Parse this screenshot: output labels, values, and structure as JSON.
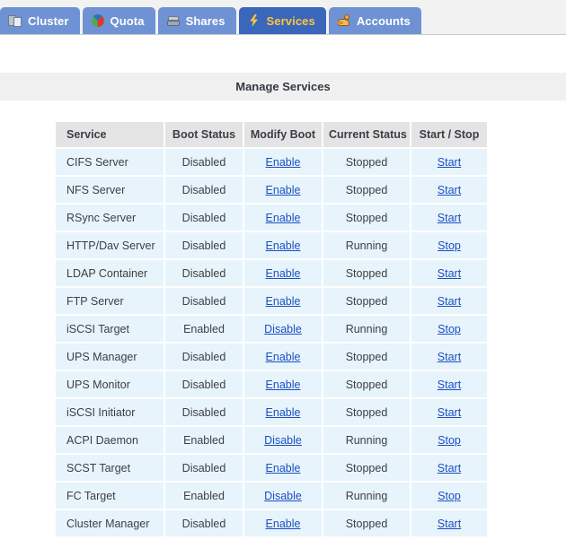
{
  "nav": {
    "tabs": [
      {
        "label": "Cluster",
        "icon": "cluster-icon",
        "active": false
      },
      {
        "label": "Quota",
        "icon": "quota-icon",
        "active": false
      },
      {
        "label": "Shares",
        "icon": "shares-icon",
        "active": false
      },
      {
        "label": "Services",
        "icon": "services-bolt-icon",
        "active": true
      },
      {
        "label": "Accounts",
        "icon": "accounts-icon",
        "active": false
      }
    ],
    "active_tab": "Services",
    "active_tab_text_color": "#ffc63c",
    "active_tab_bg_color": "#3a66bc",
    "tab_bg_color": "#6f92d4"
  },
  "banner": {
    "title": "Manage Services"
  },
  "colors": {
    "disabled_stopped": "#fcc853",
    "enabled_running": "#d9efb4",
    "row_bg": "#e8f4fb",
    "header_bg": "#e4e4e4",
    "link": "#1a4fc4"
  },
  "table": {
    "headers": {
      "service": "Service",
      "boot_status": "Boot Status",
      "modify_boot": "Modify Boot",
      "current_status": "Current Status",
      "start_stop": "Start / Stop"
    },
    "rows": [
      {
        "service": "CIFS Server",
        "boot_status": "Disabled",
        "boot_state": "off",
        "modify_boot": "Enable",
        "current_status": "Stopped",
        "run_state": "off",
        "start_stop": "Start"
      },
      {
        "service": "NFS Server",
        "boot_status": "Disabled",
        "boot_state": "off",
        "modify_boot": "Enable",
        "current_status": "Stopped",
        "run_state": "off",
        "start_stop": "Start"
      },
      {
        "service": "RSync Server",
        "boot_status": "Disabled",
        "boot_state": "off",
        "modify_boot": "Enable",
        "current_status": "Stopped",
        "run_state": "off",
        "start_stop": "Start"
      },
      {
        "service": "HTTP/Dav Server",
        "boot_status": "Disabled",
        "boot_state": "off",
        "modify_boot": "Enable",
        "current_status": "Running",
        "run_state": "on",
        "start_stop": "Stop"
      },
      {
        "service": "LDAP Container",
        "boot_status": "Disabled",
        "boot_state": "off",
        "modify_boot": "Enable",
        "current_status": "Stopped",
        "run_state": "off",
        "start_stop": "Start"
      },
      {
        "service": "FTP Server",
        "boot_status": "Disabled",
        "boot_state": "off",
        "modify_boot": "Enable",
        "current_status": "Stopped",
        "run_state": "off",
        "start_stop": "Start"
      },
      {
        "service": "iSCSI Target",
        "boot_status": "Enabled",
        "boot_state": "on",
        "modify_boot": "Disable",
        "current_status": "Running",
        "run_state": "on",
        "start_stop": "Stop"
      },
      {
        "service": "UPS Manager",
        "boot_status": "Disabled",
        "boot_state": "off",
        "modify_boot": "Enable",
        "current_status": "Stopped",
        "run_state": "off",
        "start_stop": "Start"
      },
      {
        "service": "UPS Monitor",
        "boot_status": "Disabled",
        "boot_state": "off",
        "modify_boot": "Enable",
        "current_status": "Stopped",
        "run_state": "off",
        "start_stop": "Start"
      },
      {
        "service": "iSCSI Initiator",
        "boot_status": "Disabled",
        "boot_state": "off",
        "modify_boot": "Enable",
        "current_status": "Stopped",
        "run_state": "off",
        "start_stop": "Start"
      },
      {
        "service": "ACPI Daemon",
        "boot_status": "Enabled",
        "boot_state": "on",
        "modify_boot": "Disable",
        "current_status": "Running",
        "run_state": "on",
        "start_stop": "Stop"
      },
      {
        "service": "SCST Target",
        "boot_status": "Disabled",
        "boot_state": "off",
        "modify_boot": "Enable",
        "current_status": "Stopped",
        "run_state": "off",
        "start_stop": "Start"
      },
      {
        "service": "FC Target",
        "boot_status": "Enabled",
        "boot_state": "on",
        "modify_boot": "Disable",
        "current_status": "Running",
        "run_state": "on",
        "start_stop": "Stop"
      },
      {
        "service": "Cluster Manager",
        "boot_status": "Disabled",
        "boot_state": "off",
        "modify_boot": "Enable",
        "current_status": "Stopped",
        "run_state": "off",
        "start_stop": "Start"
      }
    ]
  }
}
